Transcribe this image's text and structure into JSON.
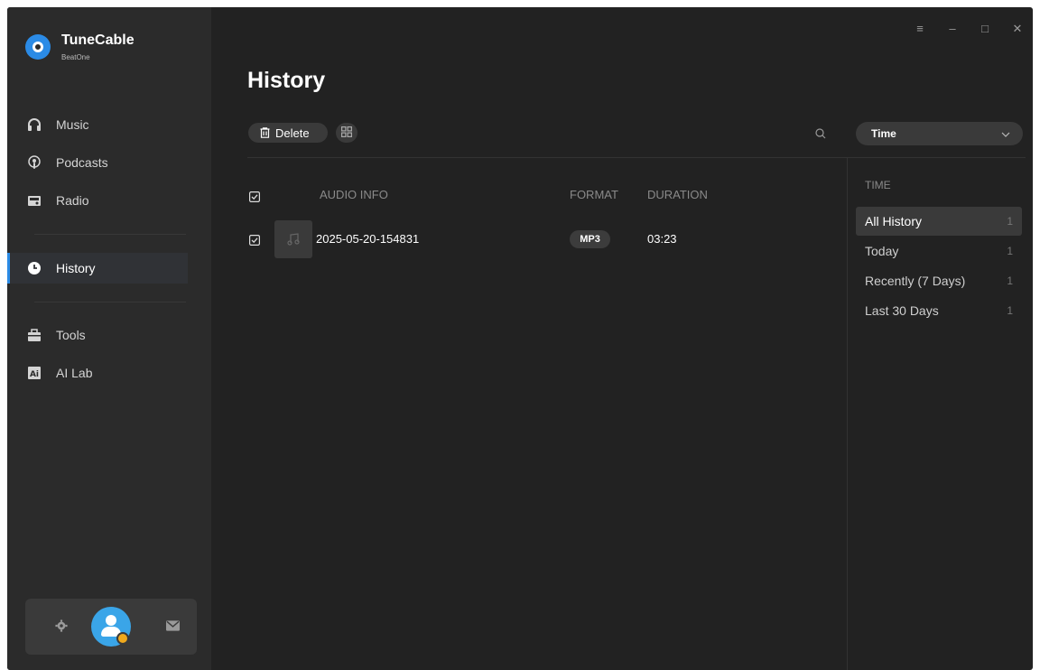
{
  "app": {
    "name": "TuneCable",
    "subtitle": "BeatOne",
    "accent": "#2b8be6"
  },
  "sidebar": {
    "items": [
      {
        "label": "Music",
        "icon": "headphones-icon"
      },
      {
        "label": "Podcasts",
        "icon": "podcast-icon"
      },
      {
        "label": "Radio",
        "icon": "radio-icon"
      },
      {
        "label": "History",
        "icon": "clock-icon",
        "active": true
      },
      {
        "label": "Tools",
        "icon": "toolbox-icon"
      },
      {
        "label": "AI Lab",
        "icon": "ai-lab-icon"
      }
    ]
  },
  "bottom": {
    "settings_icon": "gear-icon",
    "avatar_icon": "user-avatar-icon",
    "mail_icon": "mail-icon"
  },
  "window_controls": [
    "menu-icon",
    "minimize-icon",
    "maximize-icon",
    "close-icon"
  ],
  "page": {
    "title": "History"
  },
  "toolbar": {
    "delete_label": "Delete",
    "view_toggle_icon": "grid-view-icon",
    "search_icon": "search-icon",
    "sort_select": "Time"
  },
  "table": {
    "columns": [
      "AUDIO INFO",
      "FORMAT",
      "DURATION"
    ],
    "rows": [
      {
        "title": "2025-05-20-154831",
        "format": "MP3",
        "duration": "03:23",
        "checked": true
      }
    ]
  },
  "filter": {
    "heading": "TIME",
    "items": [
      {
        "label": "All History",
        "count": "1",
        "active": true
      },
      {
        "label": "Today",
        "count": "1"
      },
      {
        "label": "Recently (7 Days)",
        "count": "1"
      },
      {
        "label": "Last 30 Days",
        "count": "1"
      }
    ]
  }
}
